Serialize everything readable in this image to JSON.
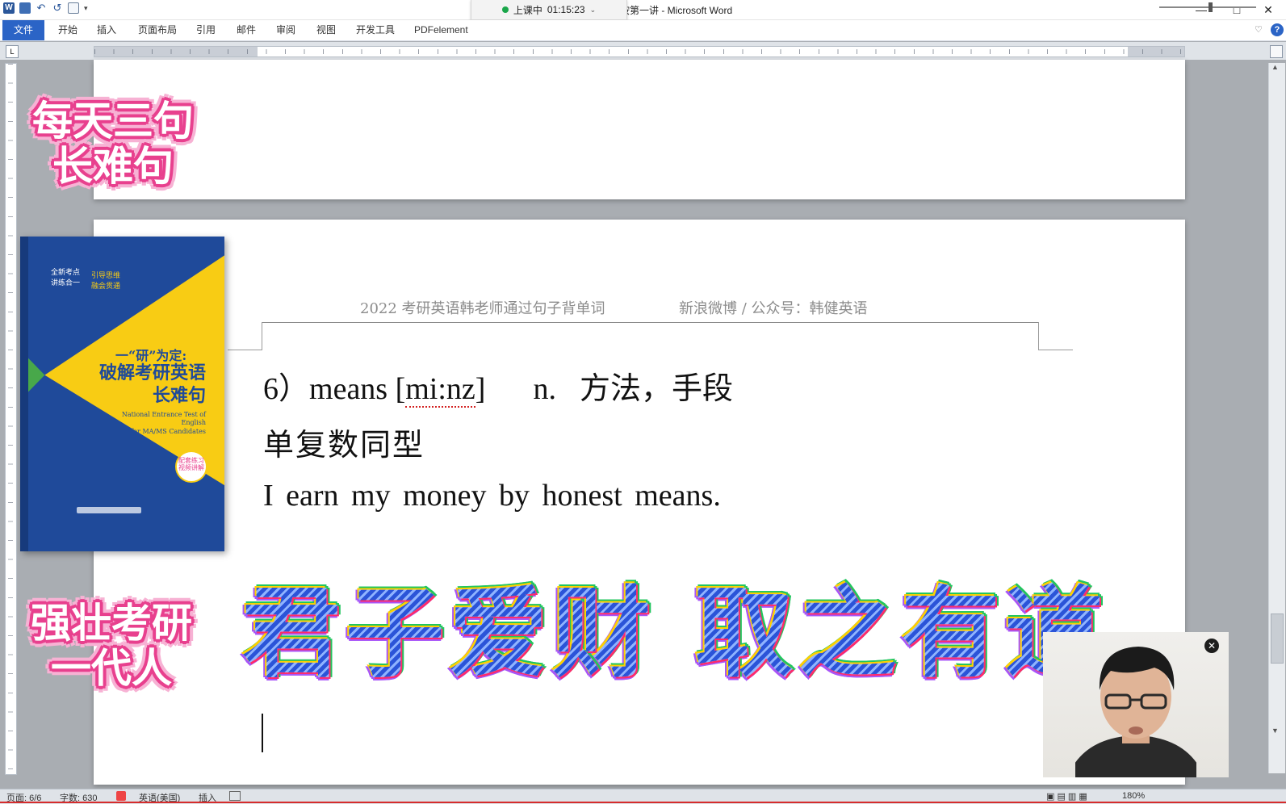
{
  "window": {
    "title": "按第一讲 - Microsoft Word",
    "minimize": "—",
    "maximize": "□",
    "close": "✕"
  },
  "quick_access": {
    "app_icon_letter": "W",
    "undo_glyph": "↶",
    "redo_glyph": "↺",
    "dropdown_glyph": "▾"
  },
  "class_timer": {
    "status": "上课中",
    "time": "01:15:23",
    "chevron": "⌄",
    "status_color": "#1aa64a"
  },
  "ribbon": {
    "tabs": [
      {
        "label": "文件"
      },
      {
        "label": "开始"
      },
      {
        "label": "插入"
      },
      {
        "label": "页面布局"
      },
      {
        "label": "引用"
      },
      {
        "label": "邮件"
      },
      {
        "label": "审阅"
      },
      {
        "label": "视图"
      },
      {
        "label": "开发工具"
      },
      {
        "label": "PDFelement"
      }
    ],
    "expand_glyph": "♡",
    "help_glyph": "?",
    "accent_color": "#2b64c6"
  },
  "ruler": {
    "tab_selector_glyph": "L"
  },
  "document": {
    "header": {
      "left": "2022 考研英语韩老师通过句子背单词",
      "right": "新浪微博 / 公众号：韩健英语"
    },
    "entry_number": "6）",
    "entry_word": "means",
    "entry_phonetic_open": "[",
    "entry_phonetic": "mi:nz",
    "entry_phonetic_close": "]",
    "entry_pos": "n.",
    "entry_meaning": "方法，手段",
    "note": "单复数同型",
    "example": "I earn my money by honest means."
  },
  "overlays": {
    "sticker_top_line1": "每天三句",
    "sticker_top_line2": "长难句",
    "sticker_bottom_line1": "强壮考研",
    "sticker_bottom_line2": "一代人",
    "slogan": "君子爱财 取之有道",
    "book": {
      "tagline_left": "全新考点\n讲练合一",
      "tagline_right": "引导思维\n融会贯通",
      "series": "一“研”为定:",
      "title_line1": "破解考研英语",
      "title_line2": "长难句",
      "english_line1": "National Entrance Test of English",
      "english_line2": "for MA/MS Candidates",
      "badge": "配套练习\n视频讲解",
      "blue": "#1f4a9a",
      "yellow": "#f8cc14"
    },
    "webcam_close_glyph": "✕"
  },
  "statusbar": {
    "page": "页面: 6/6",
    "words": "字数: 630",
    "language": "英语(美国)",
    "mode": "插入",
    "zoom": "180%"
  }
}
